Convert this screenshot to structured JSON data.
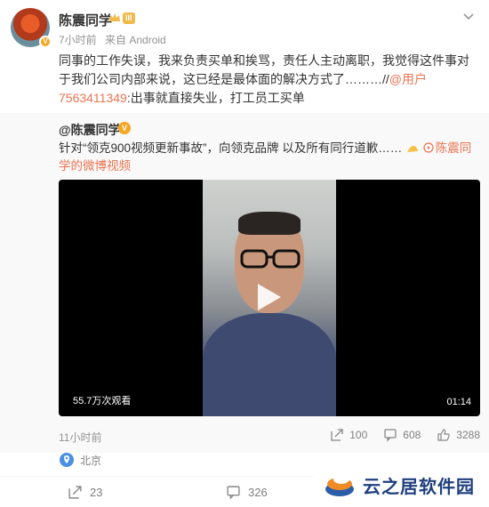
{
  "post": {
    "username": "陈震同学",
    "level": "III",
    "time": "7小时前",
    "source": "来自 Android",
    "text_before": "同事的工作失误，我来负责买单和挨骂，责任人主动离职，我觉得这件事对于我们公司内部来说，这已经是最体面的解决方式了………//",
    "mention": "@用户7563411349",
    "text_after": ":出事就直接失业，打工员工买单"
  },
  "repost": {
    "username": "@陈震同学",
    "text": "针对“领克900视频更新事故”，向领克品牌 以及所有同行道歉……",
    "video_link": "陈震同学的微博视频",
    "views": "55.7万次观看",
    "duration": "01:14",
    "time": "11小时前",
    "shares": "100",
    "comments": "608",
    "likes": "3288"
  },
  "location": "北京",
  "actions": {
    "shares": "23",
    "comments": "326"
  },
  "watermark": {
    "text": "云之居软件园"
  },
  "colors": {
    "accent": "#eb7350",
    "gray": "#939393",
    "repost_bg": "#f9f9f9"
  }
}
